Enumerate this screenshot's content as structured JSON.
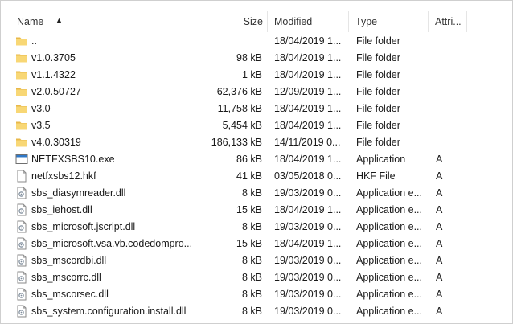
{
  "columns": {
    "name": "Name",
    "size": "Size",
    "modified": "Modified",
    "type": "Type",
    "attributes": "Attri..."
  },
  "sort_indicator": "▲",
  "rows": [
    {
      "name": "..",
      "size": "",
      "modified": "18/04/2019 1...",
      "type": "File folder",
      "attr": "",
      "icon": "folder-icon"
    },
    {
      "name": "v1.0.3705",
      "size": "98 kB",
      "modified": "18/04/2019 1...",
      "type": "File folder",
      "attr": "",
      "icon": "folder-icon"
    },
    {
      "name": "v1.1.4322",
      "size": "1 kB",
      "modified": "18/04/2019 1...",
      "type": "File folder",
      "attr": "",
      "icon": "folder-icon"
    },
    {
      "name": "v2.0.50727",
      "size": "62,376 kB",
      "modified": "12/09/2019 1...",
      "type": "File folder",
      "attr": "",
      "icon": "folder-icon"
    },
    {
      "name": "v3.0",
      "size": "11,758 kB",
      "modified": "18/04/2019 1...",
      "type": "File folder",
      "attr": "",
      "icon": "folder-icon"
    },
    {
      "name": "v3.5",
      "size": "5,454 kB",
      "modified": "18/04/2019 1...",
      "type": "File folder",
      "attr": "",
      "icon": "folder-icon"
    },
    {
      "name": "v4.0.30319",
      "size": "186,133 kB",
      "modified": "14/11/2019 0...",
      "type": "File folder",
      "attr": "",
      "icon": "folder-icon"
    },
    {
      "name": "NETFXSBS10.exe",
      "size": "86 kB",
      "modified": "18/04/2019 1...",
      "type": "Application",
      "attr": "A",
      "icon": "exe-icon"
    },
    {
      "name": "netfxsbs12.hkf",
      "size": "41 kB",
      "modified": "03/05/2018 0...",
      "type": "HKF File",
      "attr": "A",
      "icon": "file-icon"
    },
    {
      "name": "sbs_diasymreader.dll",
      "size": "8 kB",
      "modified": "19/03/2019 0...",
      "type": "Application e...",
      "attr": "A",
      "icon": "dll-icon"
    },
    {
      "name": "sbs_iehost.dll",
      "size": "15 kB",
      "modified": "18/04/2019 1...",
      "type": "Application e...",
      "attr": "A",
      "icon": "dll-icon"
    },
    {
      "name": "sbs_microsoft.jscript.dll",
      "size": "8 kB",
      "modified": "19/03/2019 0...",
      "type": "Application e...",
      "attr": "A",
      "icon": "dll-icon"
    },
    {
      "name": "sbs_microsoft.vsa.vb.codedompro...",
      "size": "15 kB",
      "modified": "18/04/2019 1...",
      "type": "Application e...",
      "attr": "A",
      "icon": "dll-icon"
    },
    {
      "name": "sbs_mscordbi.dll",
      "size": "8 kB",
      "modified": "19/03/2019 0...",
      "type": "Application e...",
      "attr": "A",
      "icon": "dll-icon"
    },
    {
      "name": "sbs_mscorrc.dll",
      "size": "8 kB",
      "modified": "19/03/2019 0...",
      "type": "Application e...",
      "attr": "A",
      "icon": "dll-icon"
    },
    {
      "name": "sbs_mscorsec.dll",
      "size": "8 kB",
      "modified": "19/03/2019 0...",
      "type": "Application e...",
      "attr": "A",
      "icon": "dll-icon"
    },
    {
      "name": "sbs_system.configuration.install.dll",
      "size": "8 kB",
      "modified": "19/03/2019 0...",
      "type": "Application e...",
      "attr": "A",
      "icon": "dll-icon"
    }
  ]
}
